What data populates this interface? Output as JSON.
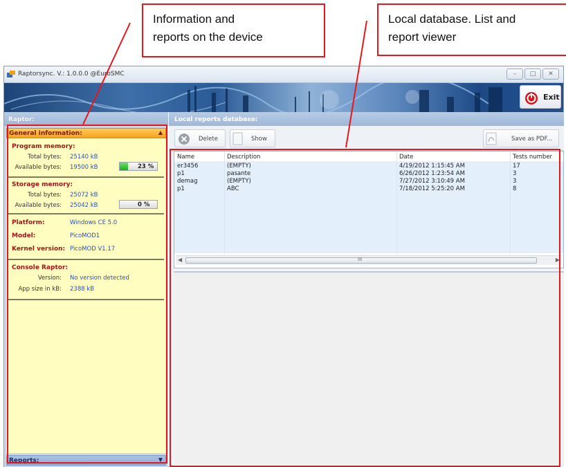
{
  "callouts": {
    "left": [
      "Information and",
      "reports on the device"
    ],
    "right": [
      "Local database. List and",
      "report viewer"
    ]
  },
  "window": {
    "title": "Raptorsync. V.: 1.0.0.0 @EuroSMC",
    "controls": [
      "minimize",
      "maximize",
      "close"
    ],
    "exit_label": "Exit"
  },
  "left_panel": {
    "header": "Raptor:",
    "general_title": "General information:",
    "program_memory": {
      "title": "Program memory:",
      "total_label": "Total bytes:",
      "total_value": "25140 kB",
      "available_label": "Available bytes:",
      "available_value": "19500 kB",
      "usage_text": "23 %",
      "usage_fraction": 0.23
    },
    "storage_memory": {
      "title": "Storage memory:",
      "total_label": "Total bytes:",
      "total_value": "25072 kB",
      "available_label": "Available bytes:",
      "available_value": "25042 kB",
      "usage_text": "0 %",
      "usage_fraction": 0.0
    },
    "platform": {
      "label": "Platform:",
      "value": "Windows CE 5.0"
    },
    "model": {
      "label": "Model:",
      "value": "PicoMOD1"
    },
    "kernel": {
      "label": "Kernel version:",
      "value": "PicoMOD V1.17"
    },
    "console": {
      "title": "Console Raptor:",
      "version_label": "Version:",
      "version_value": "No version detected",
      "app_size_label": "App size in kB:",
      "app_size_value": "2388 kB"
    },
    "reports_title": "Reports:"
  },
  "right_panel": {
    "header": "Local reports database:",
    "toolbar": {
      "delete": "Delete",
      "show": "Show",
      "save_pdf": "Save as PDF..."
    },
    "table": {
      "columns": [
        "Name",
        "Description",
        "Date",
        "Tests number"
      ],
      "rows": [
        [
          "er3456",
          "(EMPTY)",
          "4/19/2012 1:15:45 AM",
          "17"
        ],
        [
          "p1",
          "pasante",
          "6/26/2012 1:23:54 AM",
          "3"
        ],
        [
          "demag",
          "(EMPTY)",
          "7/27/2012 3:10:49 AM",
          "3"
        ],
        [
          "p1",
          "ABC",
          "7/18/2012 5:25:20 AM",
          "8"
        ]
      ]
    },
    "scroll_grip": "III"
  },
  "colors": {
    "highlight_red": "#e8161b",
    "panel_yellow": "#fffec0",
    "section_title_red": "#a5141a",
    "value_blue": "#2750b8",
    "progress_green": "#1fae1a"
  }
}
